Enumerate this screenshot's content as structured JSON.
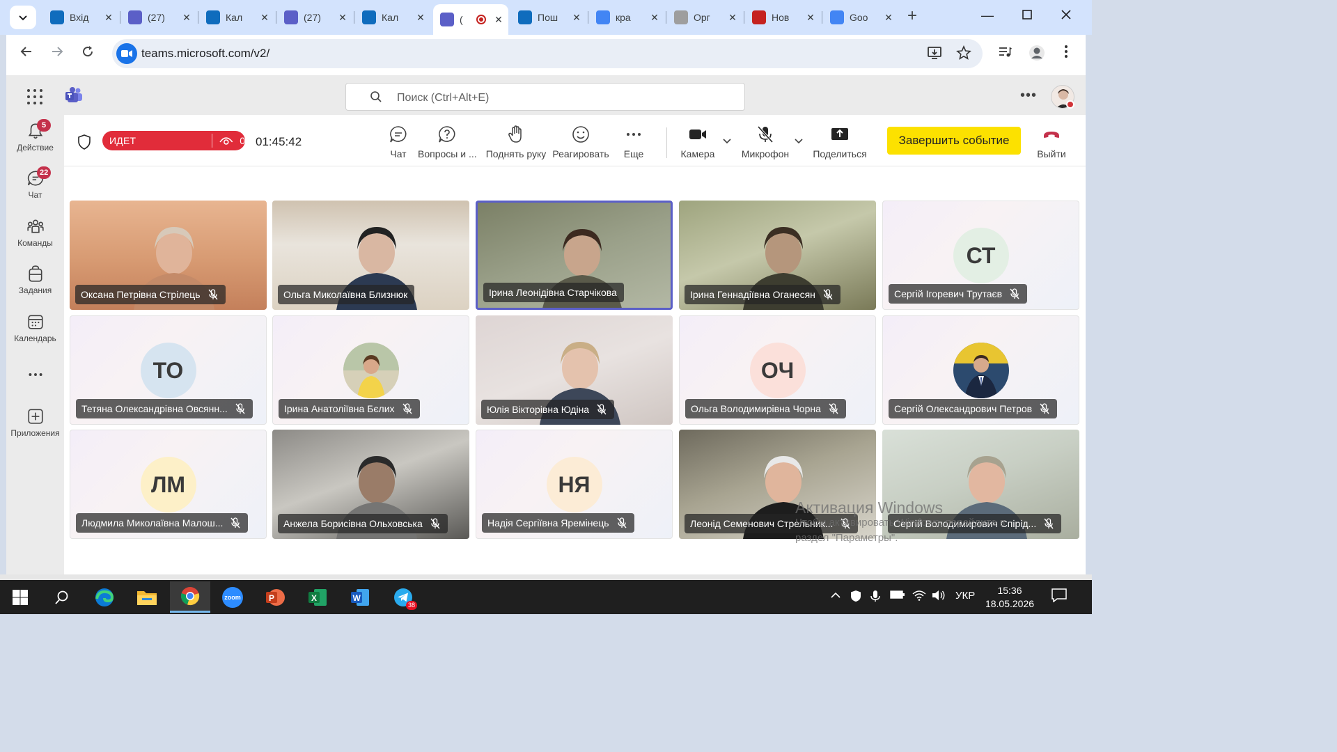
{
  "browser": {
    "tabs": [
      {
        "title": "Вхід",
        "favicon": "outlook-icon",
        "color": "#0f6cbd"
      },
      {
        "title": "(27)",
        "favicon": "teams-icon",
        "color": "#5b5fc7"
      },
      {
        "title": "Кал",
        "favicon": "calendar-icon",
        "color": "#0f6cbd"
      },
      {
        "title": "(27)",
        "favicon": "teams-icon",
        "color": "#5b5fc7"
      },
      {
        "title": "Кал",
        "favicon": "calendar-icon",
        "color": "#0f6cbd"
      },
      {
        "title": "(",
        "favicon": "teams-icon",
        "color": "#5b5fc7",
        "active": true
      },
      {
        "title": "Пош",
        "favicon": "outlook-icon",
        "color": "#0f6cbd"
      },
      {
        "title": "кра",
        "favicon": "google-icon",
        "color": "#4285f4"
      },
      {
        "title": "Орг",
        "favicon": "org-icon",
        "color": "#9e9e9e"
      },
      {
        "title": "Нов",
        "favicon": "record-icon",
        "color": "#c5221f"
      },
      {
        "title": "Goo",
        "favicon": "translate-icon",
        "color": "#4285f4"
      }
    ],
    "url": "teams.microsoft.com/v2/"
  },
  "teams": {
    "search_placeholder": "Поиск (Ctrl+Alt+E)",
    "rail": [
      {
        "label": "Действие",
        "badge": "5",
        "icon": "bell-icon"
      },
      {
        "label": "Чат",
        "badge": "22",
        "icon": "chat-icon"
      },
      {
        "label": "Команды",
        "badge": "",
        "icon": "teams-people-icon"
      },
      {
        "label": "Задания",
        "badge": "",
        "icon": "assignments-icon"
      },
      {
        "label": "Календарь",
        "badge": "",
        "icon": "calendar-icon"
      },
      {
        "label": "",
        "badge": "",
        "icon": "more-icon"
      },
      {
        "label": "Приложения",
        "badge": "",
        "icon": "apps-icon"
      }
    ]
  },
  "meeting": {
    "live_label": "ИДЕТ ТРАНСЛЯЦИЯ",
    "viewers": "0",
    "timer": "01:45:42",
    "controls": {
      "chat": "Чат",
      "qa": "Вопросы и ...",
      "raise_hand": "Поднять руку",
      "react": "Реагировать",
      "more": "Еще",
      "camera": "Камера",
      "mic": "Микрофон",
      "share": "Поделиться",
      "end_event": "Завершить событие",
      "leave": "Выйти"
    },
    "accent_color": "#5b5fc7",
    "live_color": "#e12c3a",
    "end_button_color": "#fce100",
    "participants": [
      {
        "name": "Оксана Петрівна Стрілець",
        "type": "video",
        "muted": true
      },
      {
        "name": "Ольга Миколаївна Близнюк",
        "type": "video",
        "muted": false
      },
      {
        "name": "Ірина Леонідівна Старчікова",
        "type": "video",
        "muted": false,
        "speaking": true
      },
      {
        "name": "Ірина Геннадіївна Оганесян",
        "type": "video",
        "muted": true
      },
      {
        "name": "Сергій Ігоревич Трутаєв",
        "type": "initials",
        "initials": "СТ",
        "muted": true
      },
      {
        "name": "Тетяна Олександрівна Овсянн...",
        "type": "initials",
        "initials": "ТО",
        "muted": true
      },
      {
        "name": "Ірина Анатоліївна Бєлих",
        "type": "photo",
        "muted": true
      },
      {
        "name": "Юлія Вікторівна Юдіна",
        "type": "video",
        "muted": true
      },
      {
        "name": "Ольга Володимирівна Чорна",
        "type": "initials",
        "initials": "ОЧ",
        "muted": true
      },
      {
        "name": "Сергій Олександрович Петров",
        "type": "photo",
        "muted": true
      },
      {
        "name": "Людмила Миколаївна Малош...",
        "type": "initials",
        "initials": "ЛМ",
        "muted": true
      },
      {
        "name": "Анжела Борисівна Ольховська",
        "type": "video",
        "muted": true
      },
      {
        "name": "Надія Сергіївна Яремінець",
        "type": "initials",
        "initials": "НЯ",
        "muted": true
      },
      {
        "name": "Леонід Семенович Стрельник...",
        "type": "video",
        "muted": true
      },
      {
        "name": "Сергій Володимирович Спірід...",
        "type": "video",
        "muted": true
      }
    ]
  },
  "watermark": {
    "line1": "Активация Windows",
    "line2": "Чтобы активировать Windows, перейдите в",
    "line3": "раздел \"Параметры\"."
  },
  "taskbar": {
    "apps": [
      "windows-start-icon",
      "search-icon",
      "edge-icon",
      "file-explorer-icon",
      "chrome-icon",
      "zoom-icon",
      "powerpoint-icon",
      "excel-icon",
      "word-icon",
      "telegram-icon"
    ],
    "zoom_label": "zoom",
    "telegram_badge": "38",
    "language": "УКР",
    "time": "15:36",
    "date": "18.05.2026"
  }
}
